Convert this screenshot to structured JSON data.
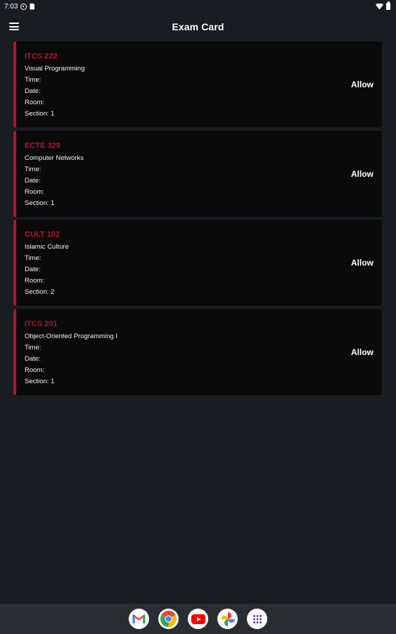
{
  "status_bar": {
    "time": "7:03",
    "icons": [
      "notification-circle-icon",
      "file-notification-icon",
      "wifi-icon",
      "battery-icon"
    ]
  },
  "app_bar": {
    "title": "Exam Card",
    "menu_icon": "hamburger-menu-icon"
  },
  "labels": {
    "time": "Time:",
    "date": "Date:",
    "room": "Room:",
    "section_prefix": "Section:"
  },
  "cards": [
    {
      "code": "ITCS 222",
      "name": "Visual Programming",
      "time": "Time:",
      "date": "Date:",
      "room": "Room:",
      "section": "Section: 1",
      "action": "Allow"
    },
    {
      "code": "ECTE 329",
      "name": "Computer Networks",
      "time": "Time:",
      "date": "Date:",
      "room": "Room:",
      "section": "Section: 1",
      "action": "Allow"
    },
    {
      "code": "CULT 102",
      "name": "Islamic Culture",
      "time": "Time:",
      "date": "Date:",
      "room": "Room:",
      "section": "Section: 2",
      "action": "Allow"
    },
    {
      "code": "ITCS 201",
      "name": "Object-Oriented Programming I",
      "time": "Time:",
      "date": "Date:",
      "room": "Room:",
      "section": "Section: 1",
      "action": "Allow"
    }
  ],
  "dock": {
    "apps": [
      "gmail-icon",
      "chrome-icon",
      "youtube-icon",
      "photos-icon",
      "app-drawer-icon"
    ]
  },
  "colors": {
    "background": "#191c20",
    "card_background": "#0b0a0b",
    "accent": "#b5122b",
    "text": "#ffffff",
    "dock": "#2a2d31"
  }
}
